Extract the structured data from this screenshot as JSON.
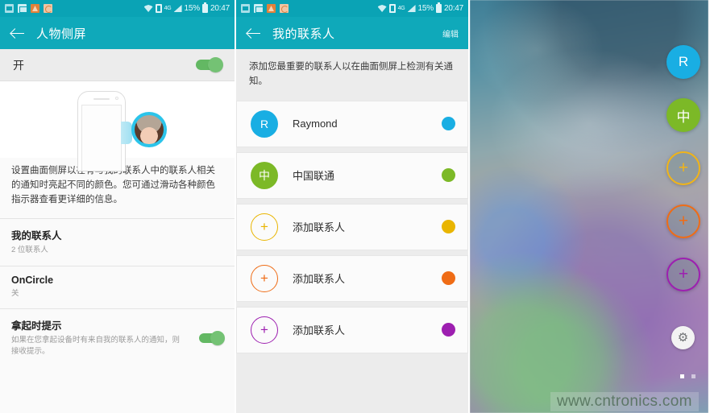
{
  "status_bar": {
    "icons": [
      "note-icon",
      "mail-icon",
      "alert-icon",
      "sync-icon"
    ],
    "wifi": "wifi-icon",
    "sim": "sim-icon",
    "network": "4G",
    "signal": "signal-icon",
    "battery_percent": "15%",
    "battery": "battery-icon",
    "time": "20:47"
  },
  "panel1": {
    "title": "人物侧屏",
    "master_toggle_label": "开",
    "master_toggle_on": true,
    "description": "设置曲面侧屏以在有与我的联系人中的联系人相关的通知时亮起不同的颜色。您可通过滑动各种颜色指示器查看更详细的信息。",
    "items": [
      {
        "title": "我的联系人",
        "sub": "2 位联系人",
        "switch": false
      },
      {
        "title": "OnCircle",
        "sub": "关",
        "switch": false
      },
      {
        "title": "拿起时提示",
        "sub": "如果在您拿起设备时有来自我的联系人的通知，则接收提示。",
        "switch": true
      }
    ]
  },
  "panel2": {
    "title": "我的联系人",
    "action": "编辑",
    "description": "添加您最重要的联系人以在曲面侧屏上检测有关通知。",
    "contacts": [
      {
        "initial": "R",
        "name": "Raymond",
        "color": "#19aee3",
        "filled": true
      },
      {
        "initial": "中",
        "name": "中国联通",
        "color": "#7cb927",
        "filled": true
      },
      {
        "initial": "+",
        "name": "添加联系人",
        "color": "#e9b500",
        "filled": false
      },
      {
        "initial": "+",
        "name": "添加联系人",
        "color": "#ef6c16",
        "filled": false
      },
      {
        "initial": "+",
        "name": "添加联系人",
        "color": "#9d1fb0",
        "filled": false
      }
    ]
  },
  "panel3": {
    "edge_buttons": [
      {
        "label": "R",
        "color": "#19aee3",
        "filled": true
      },
      {
        "label": "中",
        "color": "#7cb927",
        "filled": true
      },
      {
        "label": "+",
        "color": "#f0b419",
        "filled": false
      },
      {
        "label": "+",
        "color": "#ef6c16",
        "filled": false
      },
      {
        "label": "+",
        "color": "#9d1fb0",
        "filled": false
      }
    ],
    "settings_icon": "⚙",
    "page_dots": 2,
    "active_dot": 0,
    "watermark": "www.cntronics.com"
  }
}
